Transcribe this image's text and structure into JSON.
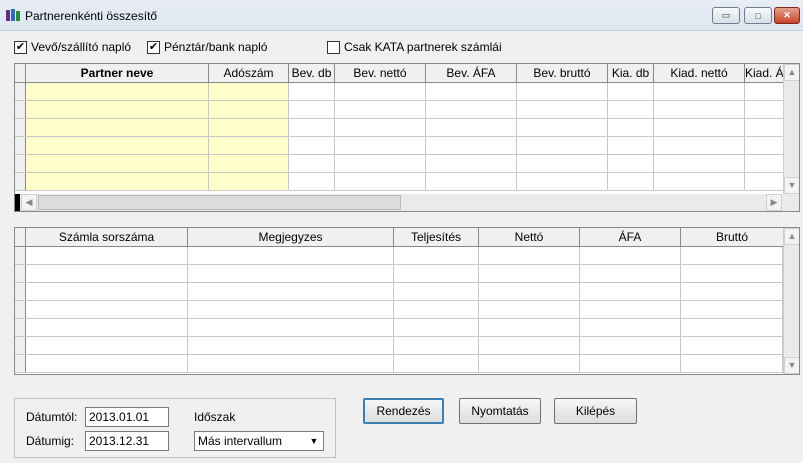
{
  "window": {
    "title": "Partnerenkénti összesítő",
    "min": "▭",
    "max": "□",
    "close": "✕"
  },
  "options": {
    "vevo": {
      "label": "Vevő/szállító napló",
      "checked": true,
      "mark": "✔"
    },
    "penztar": {
      "label": "Pénztár/bank napló",
      "checked": true,
      "mark": "✔"
    },
    "kata": {
      "label": "Csak KATA partnerek számlái",
      "checked": false,
      "mark": ""
    }
  },
  "grid1": {
    "columns": [
      "Partner neve",
      "Adószám",
      "Bev. db",
      "Bev. nettó",
      "Bev. ÁFA",
      "Bev. bruttó",
      "Kia. db",
      "Kiad. nettó",
      "Kiad. ÁFA"
    ],
    "row_count": 6
  },
  "grid2": {
    "columns": [
      "Számla sorszáma",
      "Megjegyzes",
      "Teljesítés",
      "Nettó",
      "ÁFA",
      "Bruttó"
    ],
    "row_count": 7
  },
  "filter": {
    "from_label": "Dátumtól:",
    "from_value": "2013.01.01",
    "to_label": "Dátumig:",
    "to_value": "2013.12.31",
    "period_label": "Időszak",
    "period_value": "Más intervallum"
  },
  "buttons": {
    "sort": "Rendezés",
    "print": "Nyomtatás",
    "exit": "Kilépés"
  },
  "scroll": {
    "up": "▲",
    "down": "▼",
    "left": "◀",
    "right": "▶"
  }
}
